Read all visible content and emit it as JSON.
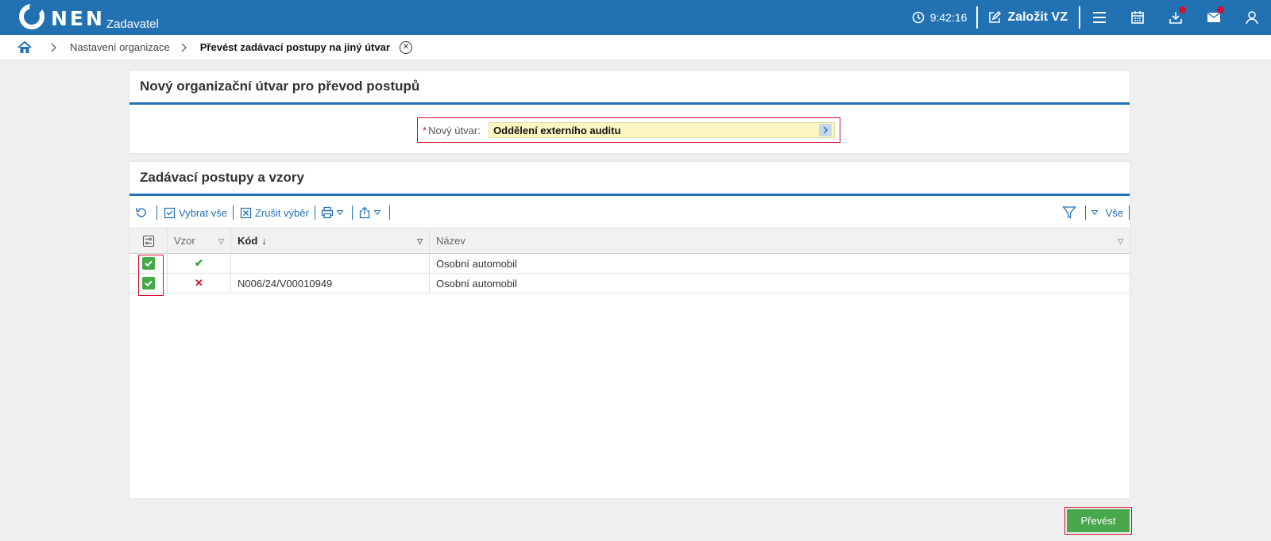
{
  "header": {
    "logo_text": "NEN",
    "logo_sub": "Zadavatel",
    "time": "9:42:16",
    "create_label": "Založit VZ"
  },
  "breadcrumb": {
    "items": [
      "Nastavení organizace"
    ],
    "current": "Převést zadávací postupy na jiný útvar"
  },
  "panel_unit": {
    "title": "Nový organizační útvar pro převod postupů",
    "field_required": "*",
    "field_label": "Nový útvar:",
    "field_value": "Oddělení externího auditu"
  },
  "panel_procedures": {
    "title": "Zadávací postupy a vzory",
    "toolbar": {
      "select_all": "Vybrat vše",
      "cancel_selection": "Zrušit výběr",
      "filter_all": "Vše"
    },
    "columns": {
      "vzor": "Vzor",
      "kod": "Kód",
      "kod_sort": "↓",
      "nazev": "Název"
    },
    "rows": [
      {
        "checked": true,
        "vzor": "✔",
        "kod": "",
        "nazev": "Osobní automobil"
      },
      {
        "checked": true,
        "vzor": "✕",
        "kod": "N006/24/V00010949",
        "nazev": "Osobní automobil"
      }
    ]
  },
  "actions": {
    "submit": "Převést"
  },
  "colors": {
    "brand": "#2271b3",
    "accent_green": "#49a84b",
    "highlight_red": "#d3102e",
    "input_yellow": "#fdf6c0"
  }
}
